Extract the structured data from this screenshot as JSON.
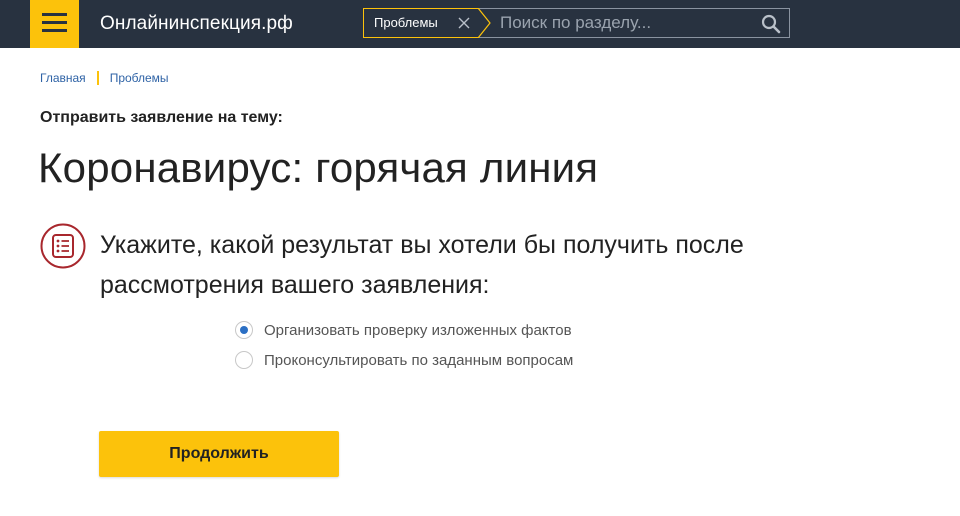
{
  "header": {
    "logo": "Онлайнинспекция.рф",
    "search": {
      "chip_label": "Проблемы",
      "placeholder": "Поиск по разделу..."
    }
  },
  "breadcrumb": {
    "items": [
      "Главная",
      "Проблемы"
    ]
  },
  "main": {
    "subtitle": "Отправить заявление на тему:",
    "title": "Коронавирус: горячая линия",
    "question": "Укажите, какой результат вы хотели бы получить после рассмотрения вашего заявления:",
    "options": [
      {
        "label": "Организовать проверку изложенных фактов",
        "selected": true
      },
      {
        "label": "Проконсультировать по заданным вопросам",
        "selected": false
      }
    ],
    "continue_label": "Продолжить"
  },
  "colors": {
    "header_bg": "#283240",
    "accent": "#fcc20b",
    "link": "#2f63a6",
    "radio_checked": "#2b6fc4",
    "icon_red": "#a8272d"
  },
  "icons": {
    "menu": "hamburger-icon",
    "chip_close": "close-icon",
    "search": "search-icon",
    "question": "list-document-icon"
  }
}
